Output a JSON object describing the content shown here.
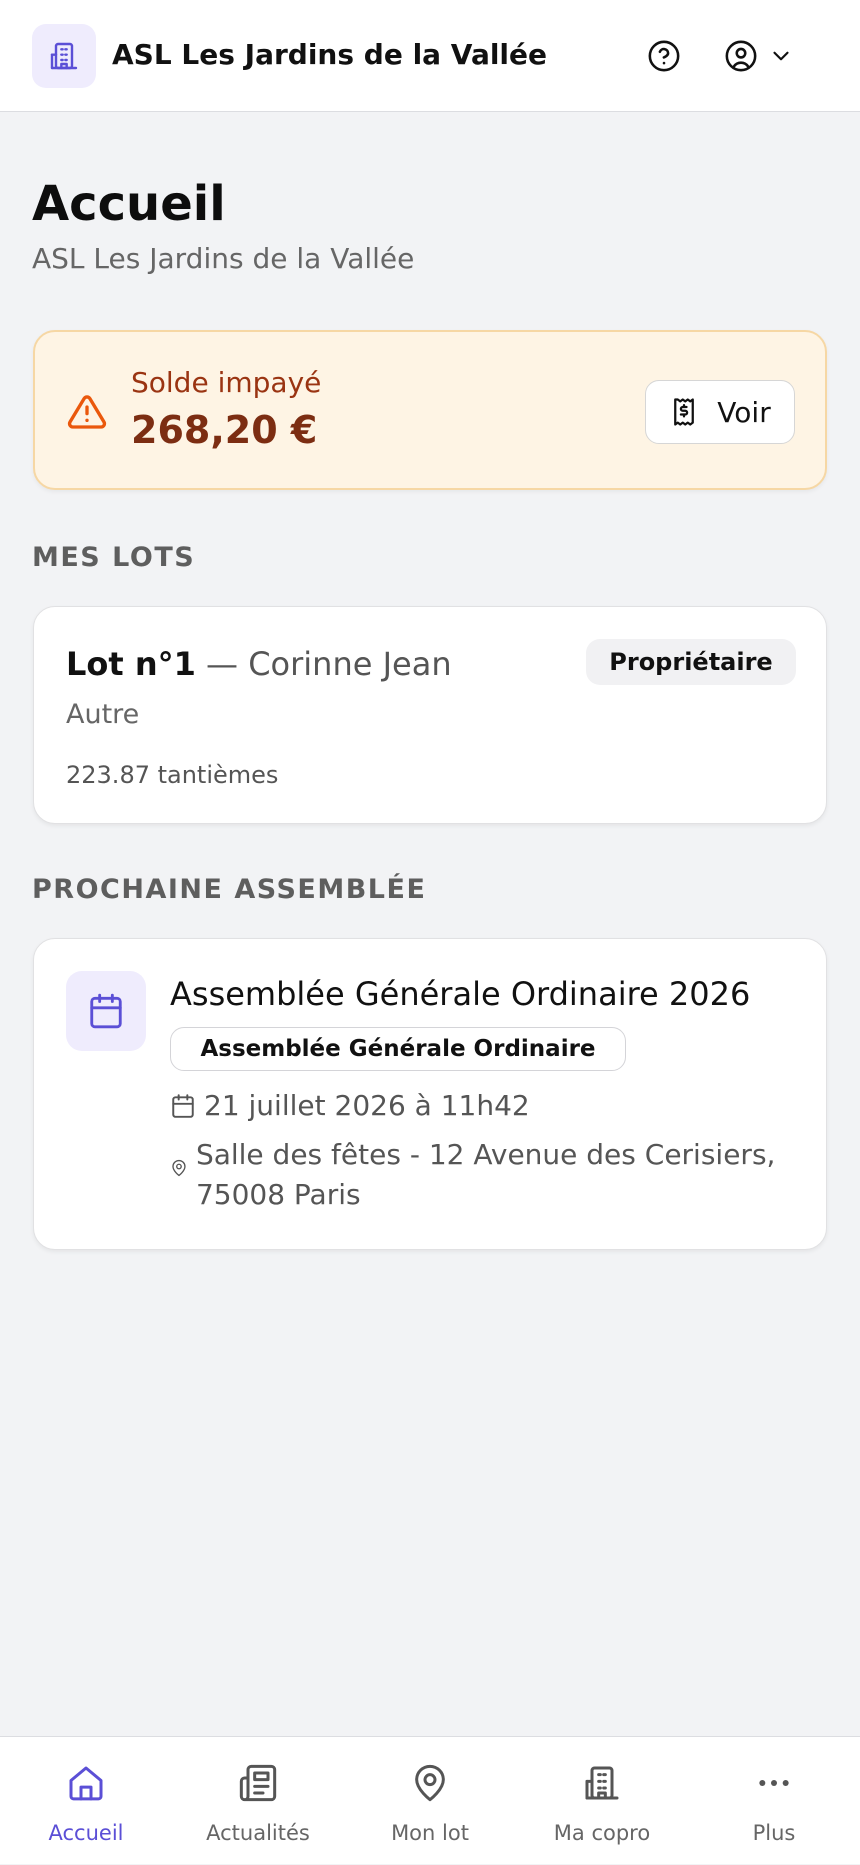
{
  "header": {
    "app_title": "ASL Les Jardins de la Vallée",
    "logo_icon": "building-icon",
    "help_icon": "help-circle-icon",
    "user_icon": "user-circle-icon",
    "dropdown_icon": "chevron-down-icon"
  },
  "page": {
    "title": "Accueil",
    "subtitle": "ASL Les Jardins de la Vallée"
  },
  "unpaid_alert": {
    "label": "Solde impayé",
    "amount": "268,20 €",
    "button_label": "Voir",
    "icon": "warning-triangle-icon",
    "button_icon": "receipt-icon"
  },
  "lots_section": {
    "heading": "MES LOTS",
    "lot": {
      "number": "Lot n°1",
      "separator_owner": " — Corinne Jean",
      "type": "Autre",
      "tantiemes": "223.87 tantièmes",
      "role_badge": "Propriétaire"
    }
  },
  "assembly_section": {
    "heading": "PROCHAINE ASSEMBLÉE",
    "assembly": {
      "title": "Assemblée Générale Ordinaire 2026",
      "type_badge": "Assemblée Générale Ordinaire",
      "date": "21 juillet 2026 à 11h42",
      "location": "Salle des fêtes - 12 Avenue des Cerisiers, 75008 Paris",
      "icon": "calendar-icon"
    }
  },
  "bottom_nav": {
    "items": [
      {
        "label": "Accueil",
        "icon": "home-icon",
        "active": true
      },
      {
        "label": "Actualités",
        "icon": "newspaper-icon",
        "active": false
      },
      {
        "label": "Mon lot",
        "icon": "map-pin-icon",
        "active": false
      },
      {
        "label": "Ma copro",
        "icon": "building-icon",
        "active": false
      },
      {
        "label": "Plus",
        "icon": "more-horizontal-icon",
        "active": false
      }
    ]
  },
  "colors": {
    "accent": "#5b4fd6",
    "alert_bg": "#fef4e4",
    "alert_text": "#7c2d12",
    "warning_icon": "#ea580c"
  }
}
